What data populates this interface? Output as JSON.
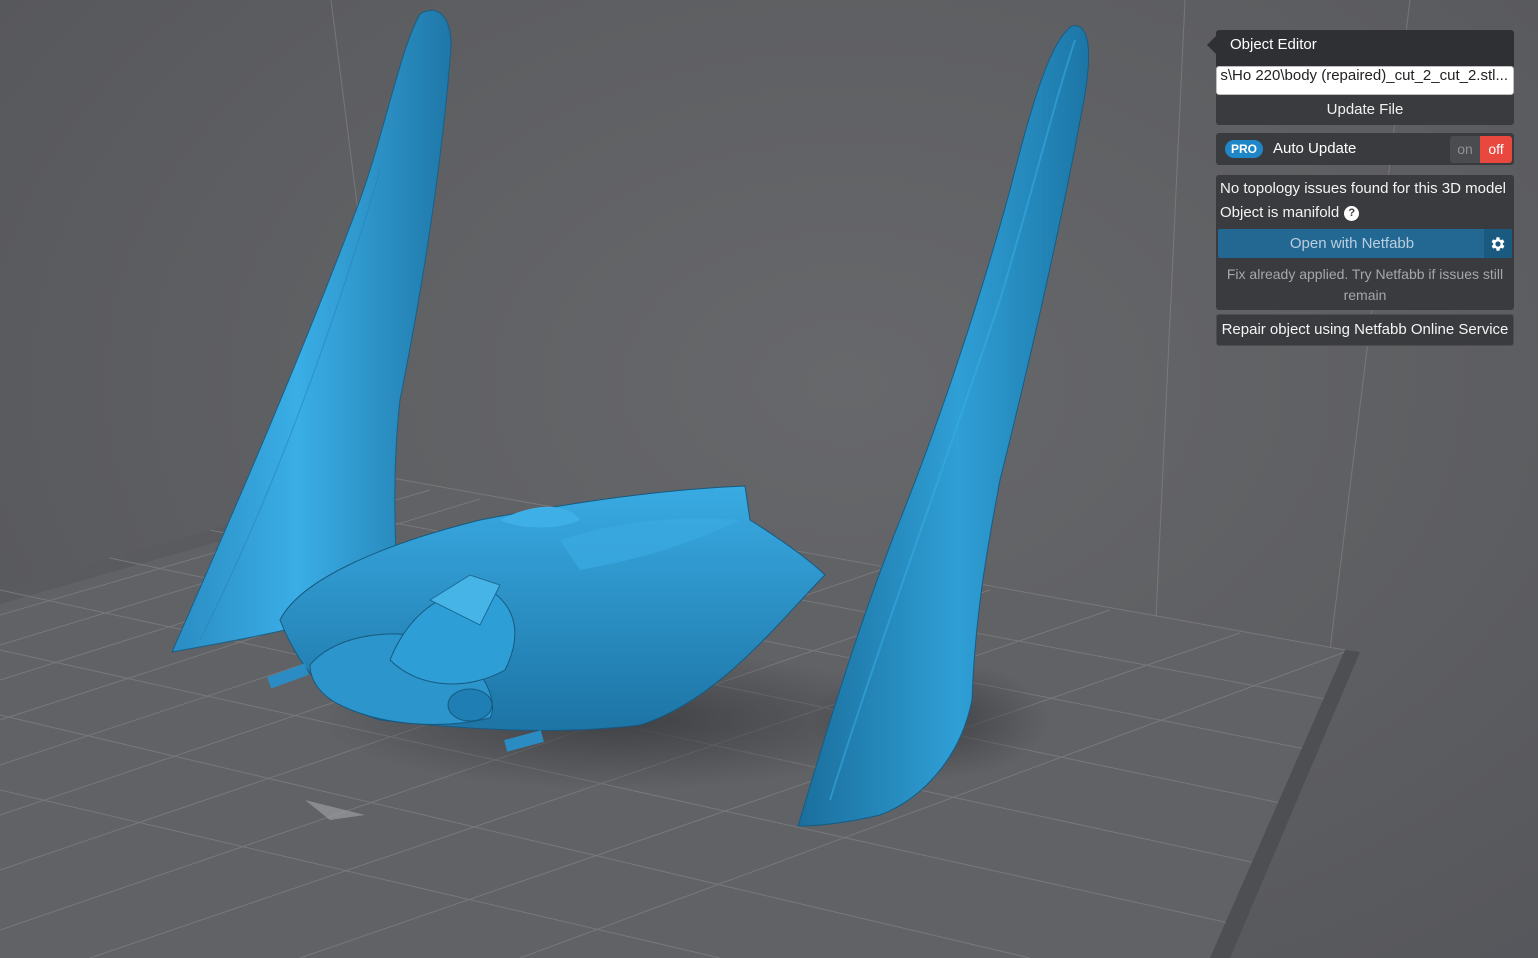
{
  "editor": {
    "title": "Object Editor",
    "file_path": "...s\\Ho 220\\body (repaired)_cut_2_cut_2.stl",
    "update_button": "Update File",
    "pro_badge": "PRO",
    "auto_update_label": "Auto Update",
    "toggle_on": "on",
    "toggle_off": "off",
    "toggle_state": "off",
    "topology_message": "No topology issues found for this 3D model",
    "manifold_message": "Object is manifold",
    "help_icon": "question-icon",
    "netfabb_button": "Open with Netfabb",
    "netfabb_settings_icon": "gear-icon",
    "fix_note": "Fix already applied. Try Netfabb if issues still remain",
    "repair_button": "Repair object using Netfabb Online Service"
  },
  "colors": {
    "viewport_bg": "#5d5e61",
    "model": "#2f9fd6",
    "panel": "#3a3b3e",
    "accent_blue": "#226892",
    "toggle_off": "#e8483d",
    "pro_badge": "#1f86c8"
  }
}
